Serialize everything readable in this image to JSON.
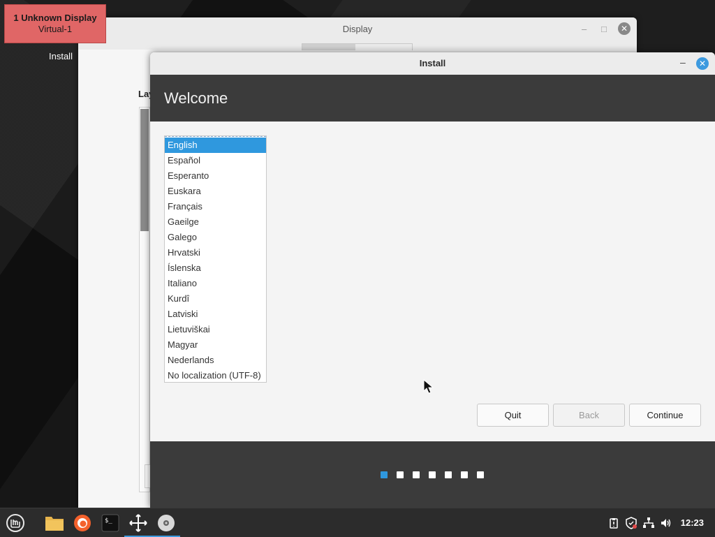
{
  "desktop": {
    "icon_label": "Install"
  },
  "display_badge": {
    "line1": "1  Unknown Display",
    "line2": "Virtual-1"
  },
  "display_window": {
    "title": "Display",
    "minimize": "–",
    "maximize": "□",
    "close": "✕",
    "section_label": "Lay"
  },
  "install_window": {
    "title": "Install",
    "minimize": "–",
    "close": "✕",
    "heading": "Welcome",
    "languages": [
      "English",
      "Español",
      "Esperanto",
      "Euskara",
      "Français",
      "Gaeilge",
      "Galego",
      "Hrvatski",
      "Íslenska",
      "Italiano",
      "Kurdî",
      "Latviski",
      "Lietuviškai",
      "Magyar",
      "Nederlands",
      "No localization (UTF-8)"
    ],
    "selected_language": "English",
    "buttons": {
      "quit": "Quit",
      "back": "Back",
      "continue": "Continue"
    },
    "progress": {
      "current_step": 1,
      "total_steps": 7
    }
  },
  "taskbar": {
    "launchers": [
      "mint-menu-icon",
      "files-icon",
      "firefox-icon",
      "terminal-icon",
      "display-move-icon",
      "installer-disc-icon"
    ],
    "tray": [
      "updates-icon",
      "shield-icon",
      "network-icon",
      "volume-icon"
    ],
    "clock": "12:23"
  },
  "colors": {
    "accent": "#2f98de",
    "header": "#3b3b3b",
    "badge": "#e06666"
  }
}
